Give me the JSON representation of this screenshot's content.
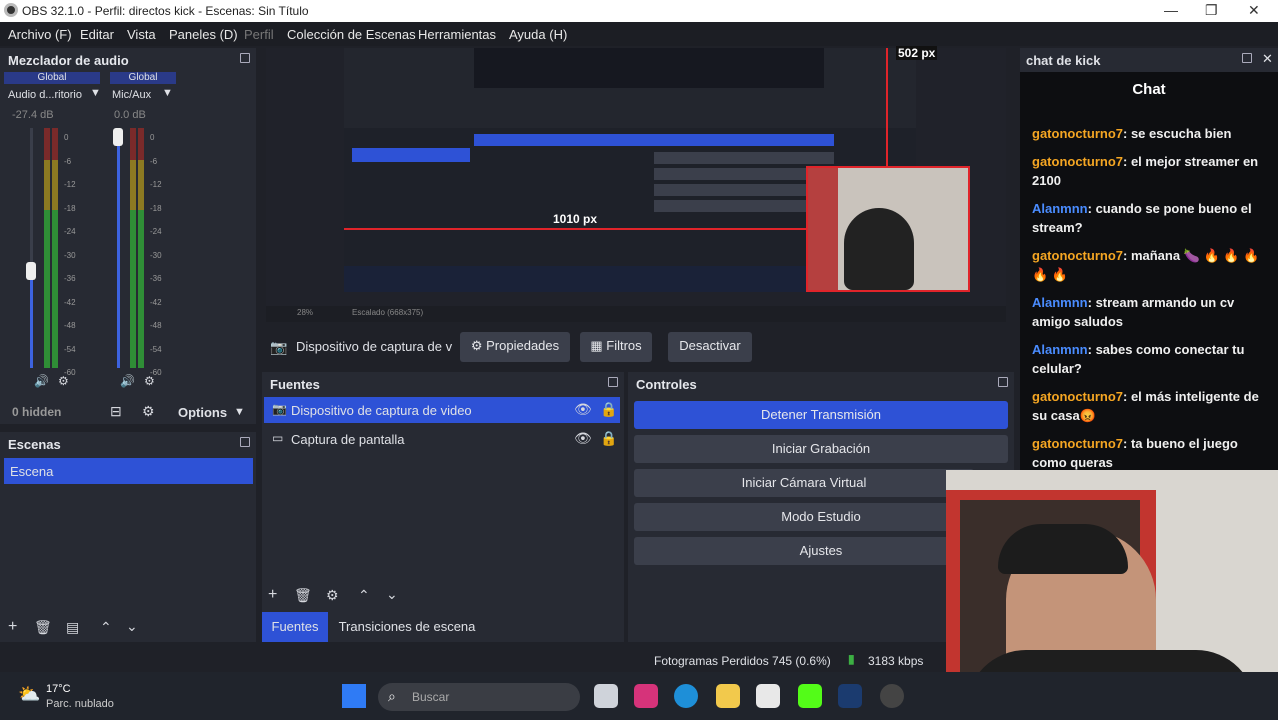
{
  "window": {
    "title": "OBS 32.1.0 - Perfil: directos kick - Escenas: Sin Título"
  },
  "menu": [
    "Archivo (F)",
    "Editar",
    "Vista",
    "Paneles (D)",
    "Perfil",
    "Colección de Escenas",
    "Herramientas",
    "Ayuda (H)"
  ],
  "mixer": {
    "title": "Mezclador de audio",
    "channels": [
      {
        "badge": "Global",
        "name": "Audio d...ritorio",
        "db": "-27.4 dB",
        "level": 0.8
      },
      {
        "badge": "Global",
        "name": "Mic/Aux",
        "db": "0.0 dB",
        "level": 1.0
      }
    ],
    "scale": [
      "0",
      "-6",
      "-12",
      "-18",
      "-24",
      "-30",
      "-36",
      "-42",
      "-48",
      "-54",
      "-60"
    ],
    "hidden": "0 hidden",
    "options": "Options"
  },
  "scenes": {
    "title": "Escenas",
    "items": [
      "Escena"
    ]
  },
  "toolbar": {
    "source": "Dispositivo de captura de v",
    "props": "Propiedades",
    "filters": "Filtros",
    "deactivate": "Desactivar"
  },
  "preview": {
    "labels": [
      "502 px",
      "1010 px"
    ],
    "zoom": "28%",
    "scale_label": "Escalado (668x375)"
  },
  "sources": {
    "title": "Fuentes",
    "items": [
      "Dispositivo de captura de video",
      "Captura de pantalla"
    ],
    "tabs": [
      "Fuentes",
      "Transiciones de escena"
    ]
  },
  "controls": {
    "title": "Controles",
    "buttons": [
      "Detener Transmisión",
      "Iniciar Grabación",
      "Iniciar Cámara Virtual",
      "Modo Estudio",
      "Ajustes"
    ]
  },
  "status": {
    "dropped": "Fotogramas Perdidos 745 (0.6%)",
    "bitrate": "3183 kbps"
  },
  "chat": {
    "dock_title": "chat de kick",
    "title": "Chat",
    "messages": [
      {
        "user": "gatonocturno7",
        "color": "#f5a623",
        "text": ": se escucha bien"
      },
      {
        "user": "gatonocturno7",
        "color": "#f5a623",
        "text": ": el mejor streamer en 2100"
      },
      {
        "user": "Alanmnn",
        "color": "#4a8cff",
        "text": ": cuando se pone bueno el stream?"
      },
      {
        "user": "gatonocturno7",
        "color": "#f5a623",
        "text": ": mañana 🍆 🔥 🔥 🔥 🔥 🔥"
      },
      {
        "user": "Alanmnn",
        "color": "#4a8cff",
        "text": ": stream armando un cv amigo saludos"
      },
      {
        "user": "Alanmnn",
        "color": "#4a8cff",
        "text": ": sabes como conectar tu celular?"
      },
      {
        "user": "gatonocturno7",
        "color": "#f5a623",
        "text": ": el más inteligente de su casa😡"
      },
      {
        "user": "gatonocturno7",
        "color": "#f5a623",
        "text": ": ta bueno el juego como queras"
      }
    ]
  },
  "taskbar": {
    "temp": "17°C",
    "weather": "Parc. nublado",
    "search": "Buscar"
  }
}
